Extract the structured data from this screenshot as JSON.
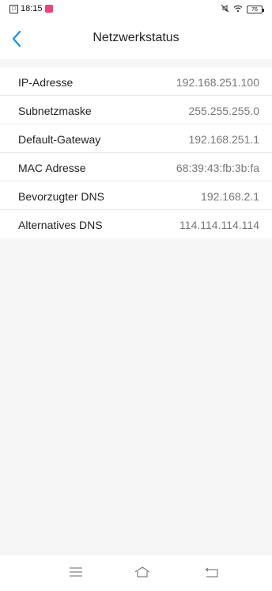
{
  "status_bar": {
    "time": "18:15",
    "battery_level": "76"
  },
  "header": {
    "title": "Netzwerkstatus"
  },
  "network_info": [
    {
      "label": "IP-Adresse",
      "value": "192.168.251.100"
    },
    {
      "label": "Subnetzmaske",
      "value": "255.255.255.0"
    },
    {
      "label": "Default-Gateway",
      "value": "192.168.251.1"
    },
    {
      "label": "MAC Adresse",
      "value": "68:39:43:fb:3b:fa"
    },
    {
      "label": "Bevorzugter DNS",
      "value": "192.168.2.1"
    },
    {
      "label": "Alternatives DNS",
      "value": "114.114.114.114"
    }
  ],
  "colors": {
    "accent": "#1a8ee6",
    "background": "#f6f6f6"
  }
}
